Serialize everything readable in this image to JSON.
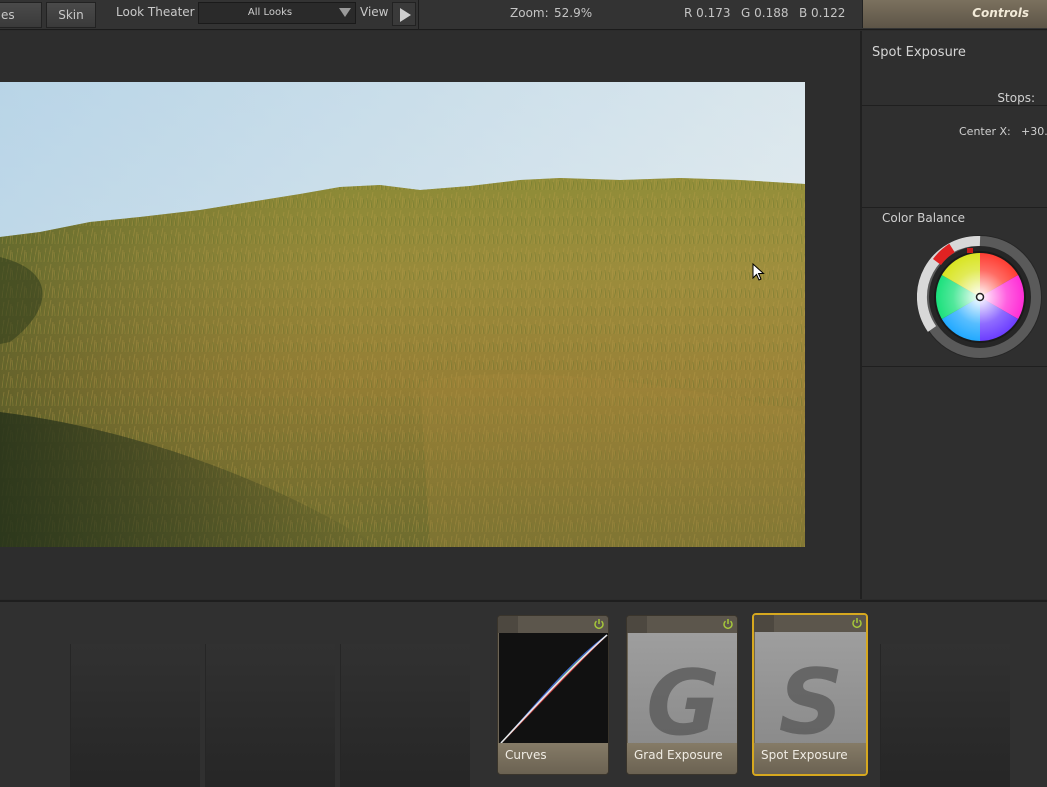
{
  "toolbar": {
    "tab_partial": "es",
    "skin_label": "Skin",
    "look_theater_label": "Look Theater",
    "looks_select_value": "All Looks",
    "view_label": "View",
    "zoom_label": "Zoom:",
    "zoom_value": "52.9%",
    "r_readout": "R 0.173",
    "g_readout": "G 0.188",
    "b_readout": "B 0.122",
    "controls_tab": "Controls"
  },
  "panel": {
    "title": "Spot Exposure",
    "stops_label": "Stops:",
    "center_x_label": "Center X:",
    "center_x_value": "+30.",
    "color_balance_label": "Color Balance"
  },
  "tools": [
    {
      "label": "Curves",
      "icon": "curves-graph"
    },
    {
      "label": "Grad Exposure",
      "letter": "G"
    },
    {
      "label": "Spot Exposure",
      "letter": "S"
    }
  ],
  "colors": {
    "accent_selected": "#d6a81f",
    "power_icon": "#a7c93a",
    "controls_tab": "#6f6553"
  }
}
